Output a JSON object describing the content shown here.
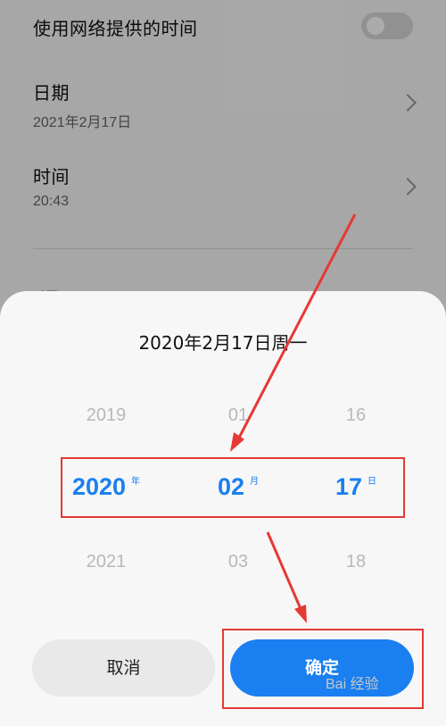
{
  "settings": {
    "network_time_label": "使用网络提供的时间",
    "date": {
      "label": "日期",
      "value": "2021年2月17日"
    },
    "time": {
      "label": "时间",
      "value": "20:43"
    },
    "timezone_label": "时区"
  },
  "picker": {
    "title": "2020年2月17日周一",
    "year": {
      "prev": "2019",
      "selected": "2020",
      "unit": "年",
      "next": "2021"
    },
    "month": {
      "prev": "01",
      "selected": "02",
      "unit": "月",
      "next": "03"
    },
    "day": {
      "prev": "16",
      "selected": "17",
      "unit": "日",
      "next": "18"
    },
    "cancel_label": "取消",
    "confirm_label": "确定"
  },
  "watermark": "Bai 经验",
  "colors": {
    "accent": "#1a7ff0",
    "annotation": "#e53935"
  }
}
